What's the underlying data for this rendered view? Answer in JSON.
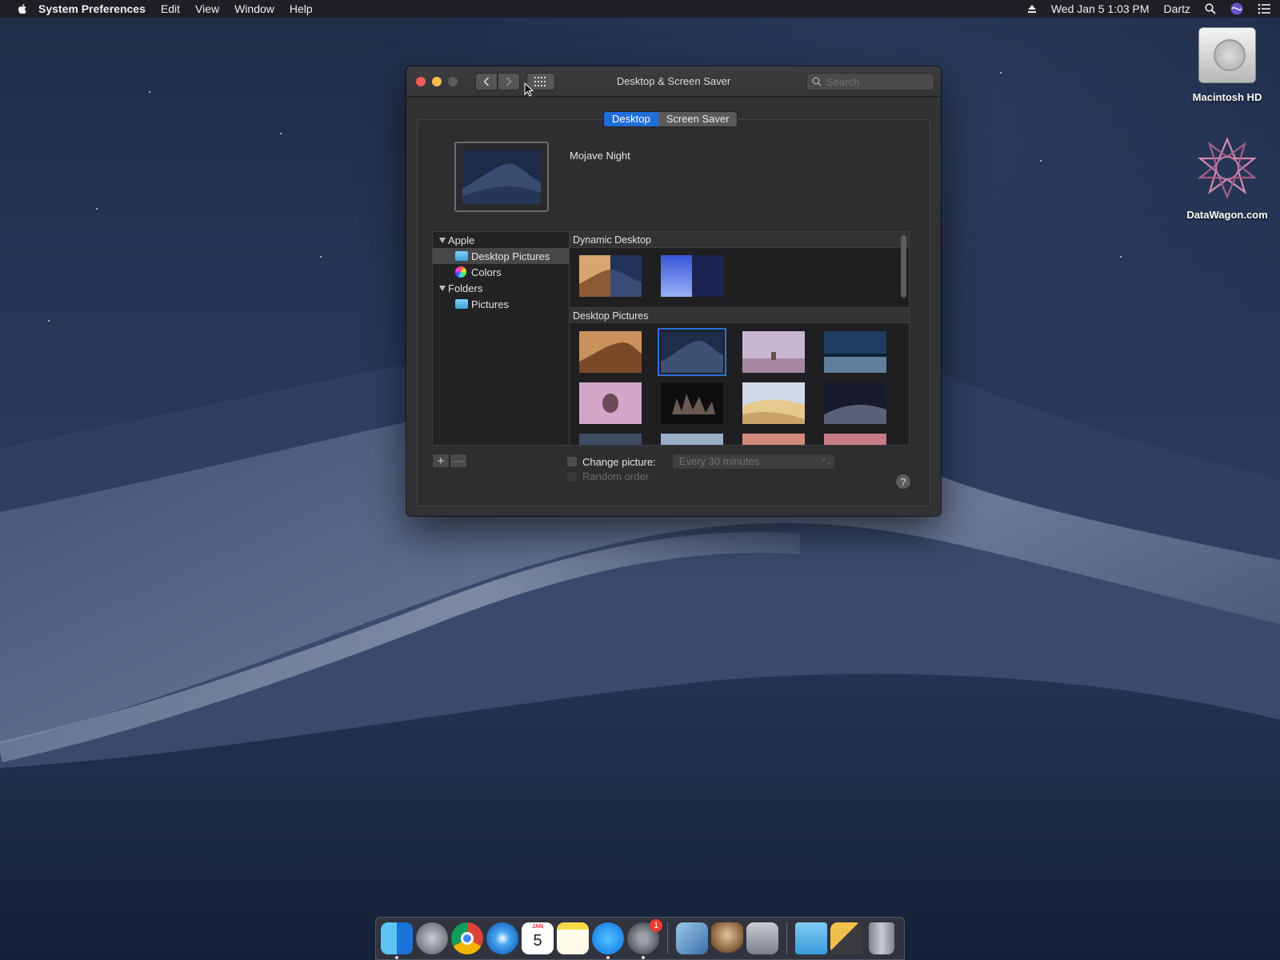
{
  "menubar": {
    "app_name": "System Preferences",
    "menus": [
      "Edit",
      "View",
      "Window",
      "Help"
    ],
    "datetime": "Wed Jan 5  1:03 PM",
    "user": "Dartz"
  },
  "desktop": {
    "icons": [
      {
        "label": "Macintosh HD"
      },
      {
        "label": "DataWagon.com"
      }
    ]
  },
  "window": {
    "title": "Desktop & Screen Saver",
    "search_placeholder": "Search",
    "tabs": [
      {
        "label": "Desktop",
        "active": true
      },
      {
        "label": "Screen Saver",
        "active": false
      }
    ],
    "current_wallpaper": "Mojave Night",
    "sidebar": {
      "groups": [
        {
          "label": "Apple",
          "items": [
            "Desktop Pictures",
            "Colors"
          ]
        },
        {
          "label": "Folders",
          "items": [
            "Pictures"
          ]
        }
      ],
      "selected": "Desktop Pictures"
    },
    "sections": [
      {
        "title": "Dynamic Desktop"
      },
      {
        "title": "Desktop Pictures"
      }
    ],
    "change_picture_label": "Change picture:",
    "interval_value": "Every 30 minutes",
    "random_order_label": "Random order",
    "help_label": "?",
    "add_label": "+",
    "remove_label": "—"
  },
  "dock": {
    "apps": [
      "finder-icon",
      "launchpad-icon",
      "chrome-icon",
      "safari-icon",
      "calendar-icon",
      "notes-icon",
      "app-store-icon",
      "system-preferences-icon",
      "preview-icon",
      "chess-icon",
      "screenshot-icon",
      "downloads-folder-icon",
      "applications-stack-icon",
      "trash-icon"
    ],
    "calendar_day": "5",
    "calendar_month": "JAN",
    "sysprefs_badge": "1"
  },
  "colors": {
    "accent": "#1f6fdb",
    "close": "#ee5e57",
    "minimize": "#f5bd4f"
  }
}
